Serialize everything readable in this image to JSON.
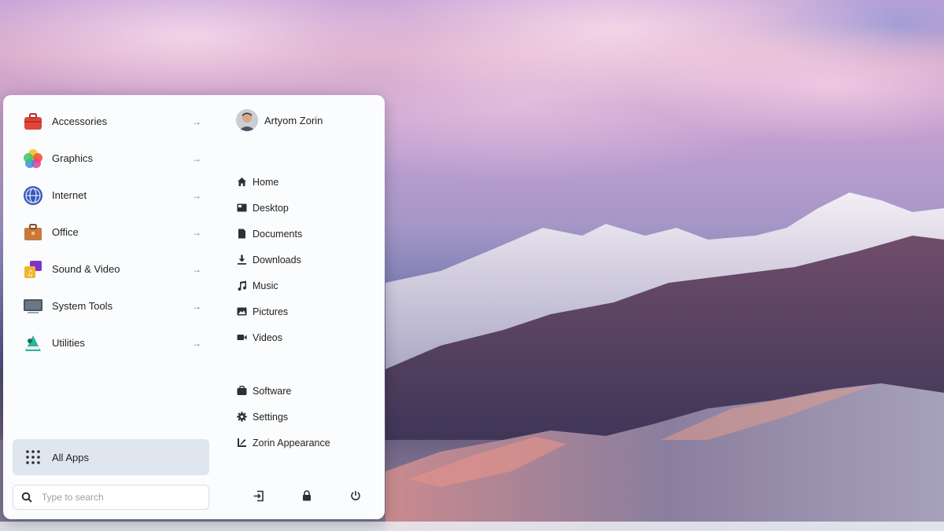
{
  "categories": [
    {
      "label": "Accessories",
      "icon": "toolbox-icon"
    },
    {
      "label": "Graphics",
      "icon": "graphics-icon"
    },
    {
      "label": "Internet",
      "icon": "globe-icon"
    },
    {
      "label": "Office",
      "icon": "briefcase-icon"
    },
    {
      "label": "Sound & Video",
      "icon": "music-video-icon"
    },
    {
      "label": "System Tools",
      "icon": "monitor-icon"
    },
    {
      "label": "Utilities",
      "icon": "utilities-icon"
    }
  ],
  "all_apps": {
    "label": "All Apps"
  },
  "search": {
    "placeholder": "Type to search"
  },
  "user": {
    "name": "Artyom Zorin"
  },
  "places": [
    {
      "label": "Home",
      "icon": "home-icon"
    },
    {
      "label": "Desktop",
      "icon": "desktop-icon"
    },
    {
      "label": "Documents",
      "icon": "document-icon"
    },
    {
      "label": "Downloads",
      "icon": "download-icon"
    },
    {
      "label": "Music",
      "icon": "music-icon"
    },
    {
      "label": "Pictures",
      "icon": "picture-icon"
    },
    {
      "label": "Videos",
      "icon": "video-icon"
    }
  ],
  "system_items": [
    {
      "label": "Software",
      "icon": "software-icon"
    },
    {
      "label": "Settings",
      "icon": "gear-icon"
    },
    {
      "label": "Zorin Appearance",
      "icon": "appearance-icon"
    }
  ],
  "session": [
    {
      "icon": "logout-icon"
    },
    {
      "icon": "lock-icon"
    },
    {
      "icon": "power-icon"
    }
  ],
  "colors": {
    "menu_bg": "#fbfcfd",
    "selected_bg": "#dfe6ef",
    "text": "#222222",
    "icon_dark": "#2b2f36"
  }
}
